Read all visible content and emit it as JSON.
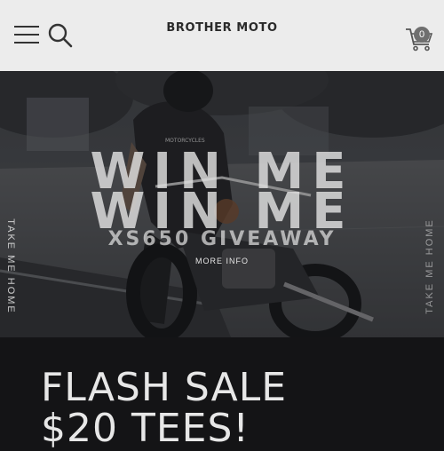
{
  "header": {
    "brand": "BROTHER MOTO",
    "cart_count": "0",
    "icons": {
      "menu": "hamburger-menu-icon",
      "search": "search-icon",
      "cart": "shopping-cart-icon"
    }
  },
  "hero": {
    "side_left": "TAKE ME HOME",
    "side_right": "TAKE ME HOME",
    "headline_1": "WIN ME",
    "headline_2": "WIN ME",
    "subheadline": "XS650 GIVEAWAY",
    "link_label": "MORE INFO",
    "shirt_text": "MOTORCYCLES"
  },
  "promo": {
    "line_1": "FLASH SALE",
    "line_2": "$20 TEES!"
  },
  "colors": {
    "header_bg": "#ececec",
    "page_bg": "#141416",
    "text_light": "#e7e7e7",
    "cart_badge": "#6f6f6f"
  }
}
